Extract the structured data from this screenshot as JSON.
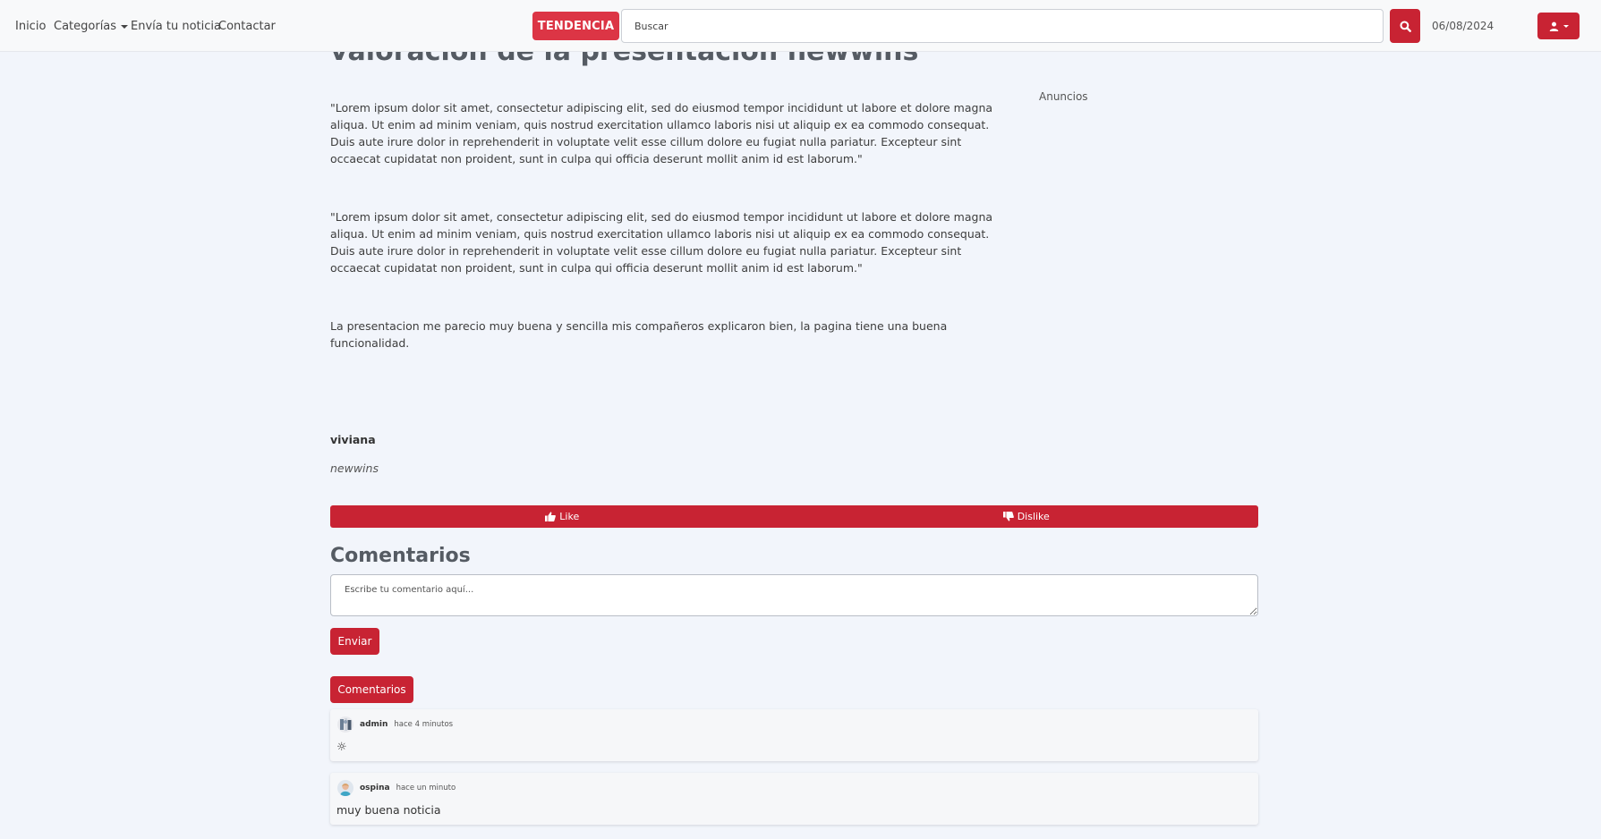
{
  "nav": {
    "links": [
      "Inicio",
      "Categorías",
      "Envía tu noticia",
      "Contactar"
    ],
    "trend_label": "TENDENCIA",
    "search_placeholder": "Buscar",
    "date": "06/08/2024",
    "accent_color": "#c82333",
    "icons": {
      "search": "search-icon",
      "user": "user-icon",
      "dropdown": "chevron-down-icon"
    }
  },
  "article": {
    "title": "valoracion de la presentacion newwins",
    "paragraphs": [
      "\"Lorem ipsum dolor sit amet, consectetur adipiscing elit, sed do eiusmod tempor incididunt ut labore et dolore magna aliqua. Ut enim ad minim veniam, quis nostrud exercitation ullamco laboris nisi ut aliquip ex ea commodo consequat. Duis aute irure dolor in reprehenderit in voluptate velit esse cillum dolore eu fugiat nulla pariatur. Excepteur sint occaecat cupidatat non proident, sunt in culpa qui officia deserunt mollit anim id est laborum.\"",
      "\"Lorem ipsum dolor sit amet, consectetur adipiscing elit, sed do eiusmod tempor incididunt ut labore et dolore magna aliqua. Ut enim ad minim veniam, quis nostrud exercitation ullamco laboris nisi ut aliquip ex ea commodo consequat. Duis aute irure dolor in reprehenderit in voluptate velit esse cillum dolore eu fugiat nulla pariatur. Excepteur sint occaecat cupidatat non proident, sunt in culpa qui officia deserunt mollit anim id est laborum.\"",
      "La presentacion me parecio muy buena y sencilla mis compañeros explicaron bien, la pagina tiene una buena funcionalidad."
    ],
    "author": "viviana",
    "site": "newwins"
  },
  "sidebar": {
    "ads_label": "Anuncios"
  },
  "reactions": {
    "like_label": "Like",
    "dislike_label": "Dislike"
  },
  "comments": {
    "heading": "Comentarios",
    "placeholder": "Escribe tu comentario aquí...",
    "send_label": "Enviar",
    "list_button_label": "Comentarios",
    "items": [
      {
        "author": "admin",
        "time": "hace 4 minutos",
        "body": "☼"
      },
      {
        "author": "ospina",
        "time": "hace un minuto",
        "body": "muy buena noticia"
      }
    ]
  }
}
